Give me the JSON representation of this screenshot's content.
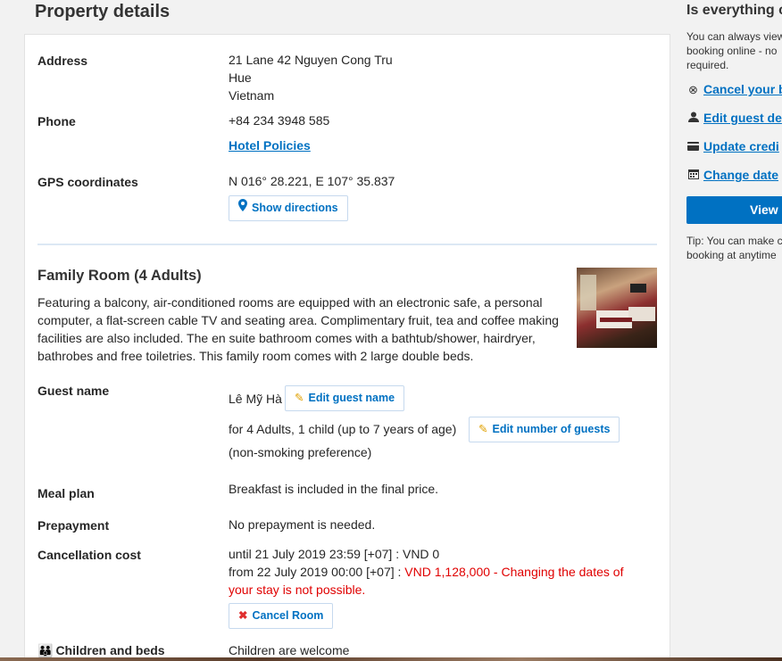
{
  "page": {
    "title": "Property details"
  },
  "property": {
    "address_label": "Address",
    "address_line1": "21 Lane 42 Nguyen Cong Tru",
    "address_line2": "Hue",
    "address_line3": "Vietnam",
    "phone_label": "Phone",
    "phone_value": "+84 234 3948 585",
    "policies_link": "Hotel Policies",
    "gps_label": "GPS coordinates",
    "gps_value": "N 016° 28.221, E 107° 35.837",
    "directions_button": "Show directions",
    "directions_icon": "map-pin-icon"
  },
  "room": {
    "title": "Family Room (4 Adults)",
    "description": "Featuring a balcony, air-conditioned rooms are equipped with an electronic safe, a personal computer, a flat-screen cable TV and seating area. Complimentary fruit, tea and coffee making facilities are also included. The en suite bathroom comes with a bathtub/shower, hairdryer, bathrobes and free toiletries. This family room comes with 2 large double beds.",
    "guest_label": "Guest name",
    "guest_name": "Lê Mỹ Hà",
    "edit_guest_button": "Edit guest name",
    "occupancy": "for 4 Adults, 1 child (up to 7 years of age)",
    "edit_guests_button": "Edit number of guests",
    "smoking": "(non-smoking preference)",
    "meal_label": "Meal plan",
    "meal_value": "Breakfast is included in the final price.",
    "prepayment_label": "Prepayment",
    "prepayment_value": "No prepayment is needed.",
    "cancellation_label": "Cancellation cost",
    "cancel_line1": "until 21 July 2019 23:59 [+07] : VND 0",
    "cancel_line2_prefix": "from 22 July 2019 00:00 [+07] : ",
    "cancel_line2_red_a": "VND 1,128,000 - Changing the dates of",
    "cancel_line2_red_b": "your stay is not possible.",
    "cancel_room_button": "Cancel Room",
    "children_label": "Children and beds",
    "children_value": "Children are welcome"
  },
  "sidebar": {
    "title": "Is everything c",
    "text_line1": "You can always view",
    "text_line2": "booking online - no",
    "text_line3": "required.",
    "links": [
      {
        "label": "Cancel your b",
        "icon": "cancel-circle-icon"
      },
      {
        "label": "Edit guest de",
        "icon": "user-icon"
      },
      {
        "label": "Update credi",
        "icon": "credit-card-icon"
      },
      {
        "label": "Change date",
        "icon": "calendar-icon"
      }
    ],
    "view_button": "View",
    "tip_line1": "Tip: You can make c",
    "tip_line2": "booking at anytime"
  },
  "colors": {
    "link": "#0071c2",
    "alert": "#e00000",
    "divider": "#dce8f4"
  }
}
